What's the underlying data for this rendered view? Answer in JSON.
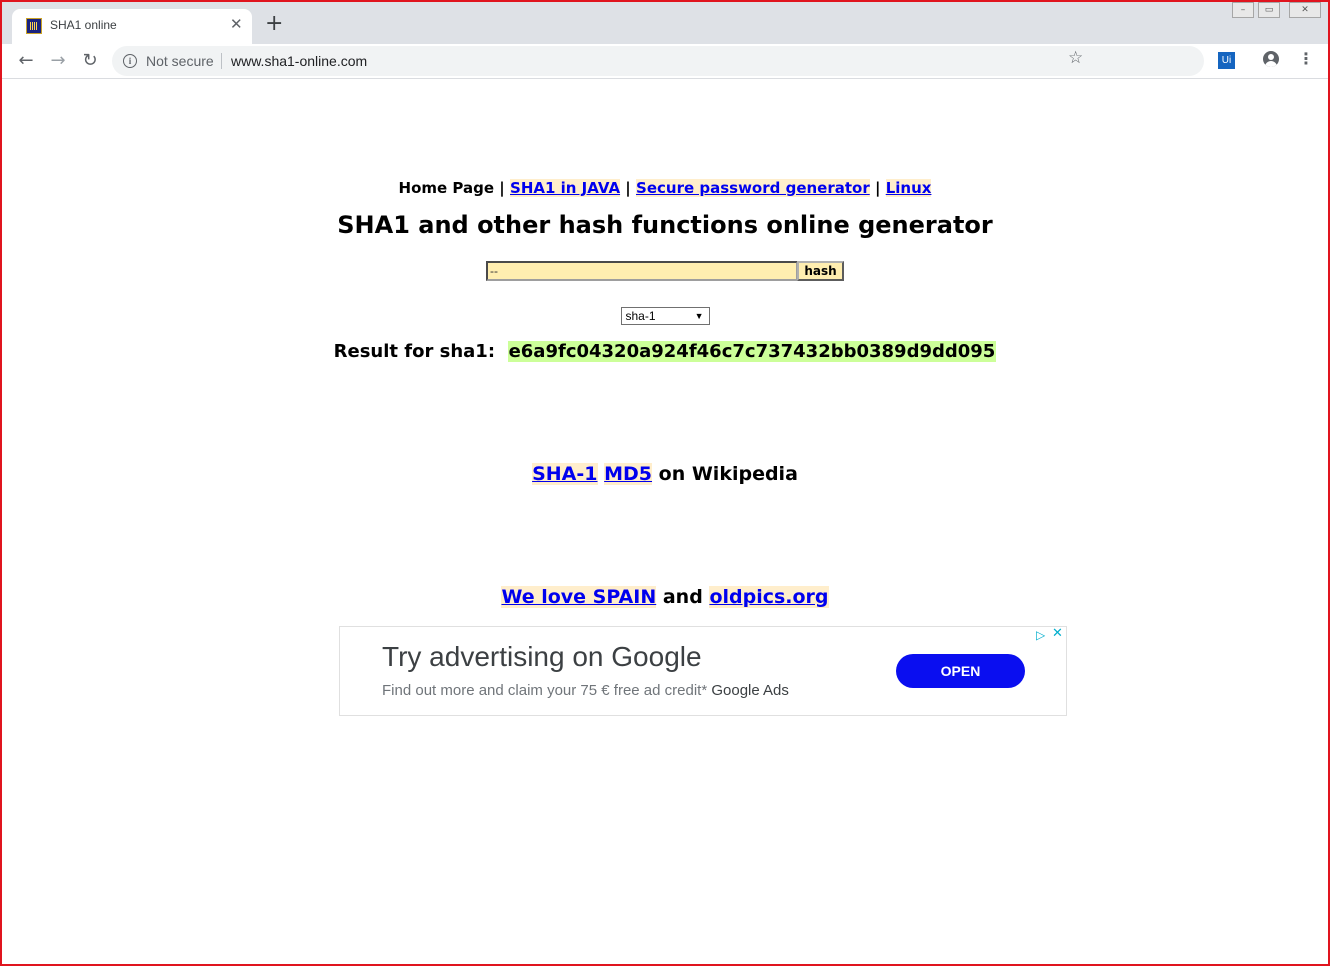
{
  "browser": {
    "tab_title": "SHA1 online",
    "tab_close_glyph": "✕",
    "new_tab_glyph": "+",
    "window_controls": [
      "–",
      "▭",
      "✕"
    ],
    "nav": {
      "back": "←",
      "forward": "→",
      "reload": "↻"
    },
    "security_label": "Not secure",
    "url": "www.sha1-online.com",
    "bookmark_glyph": "☆",
    "extension_label": "Ui",
    "menu_glyph": "⋮"
  },
  "page": {
    "nav": {
      "home": "Home Page",
      "separator": "|",
      "links": [
        "SHA1 in JAVA",
        "Secure password generator",
        "Linux"
      ]
    },
    "headline": "SHA1 and other hash functions online generator",
    "input_value": "--",
    "hash_button": "hash",
    "algorithm_selected": "sha-1",
    "select_caret": "▼",
    "result_label": "Result for sha1:",
    "result_value": "e6a9fc04320a924f46c7c737432bb0389d9dd095",
    "wiki": {
      "link1": "SHA-1",
      "link2": "MD5",
      "suffix": "on Wikipedia"
    },
    "spain": {
      "link1": "We love SPAIN",
      "middle": "and",
      "link2": "oldpics.org"
    }
  },
  "ad": {
    "title": "Try advertising on Google",
    "description": "Find out more and claim your 75 € free ad credit*",
    "brand": "Google Ads",
    "button": "OPEN",
    "choices_glyph": "▷",
    "close_glyph": "✕"
  },
  "colors": {
    "frame_border": "#e0141e",
    "link": "#0000ee",
    "link_background": "#ffeecc",
    "result_highlight": "#ccff99",
    "input_background": "#ffeeb0",
    "ad_button": "#0a0ef0"
  },
  "icons": [
    "tab-favicon",
    "close-icon",
    "plus-icon",
    "back-arrow-icon",
    "forward-arrow-icon",
    "reload-icon",
    "info-icon",
    "star-icon",
    "extension-icon",
    "profile-icon",
    "menu-dots-icon",
    "ad-choices-icon",
    "ad-close-icon"
  ]
}
